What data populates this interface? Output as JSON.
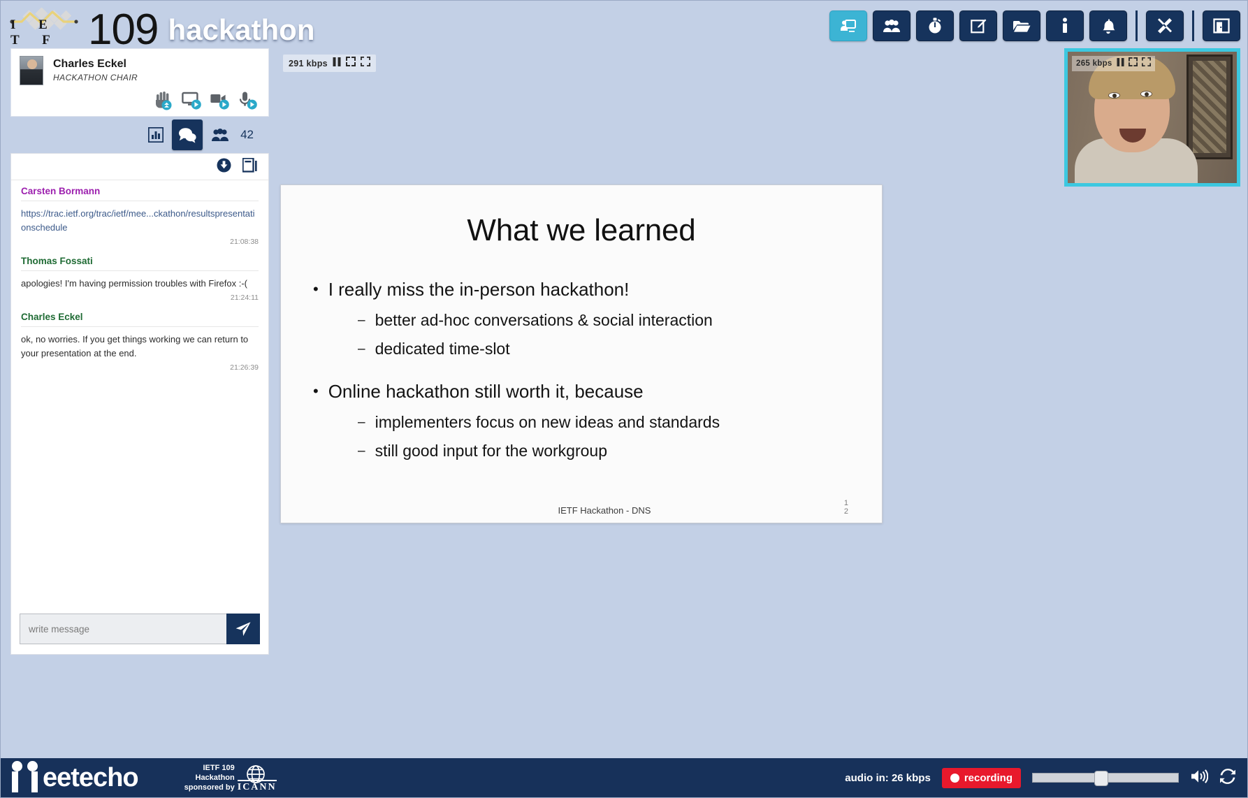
{
  "header": {
    "logo_letters": "I E T F",
    "number": "109",
    "event": "hackathon"
  },
  "toolbar": {
    "buttons": [
      {
        "name": "presentation-icon",
        "label": "Presentation",
        "active": true
      },
      {
        "name": "participants-icon",
        "label": "Participants",
        "active": false
      },
      {
        "name": "timer-icon",
        "label": "Timer",
        "active": false
      },
      {
        "name": "notes-icon",
        "label": "Notes",
        "active": false
      },
      {
        "name": "folder-icon",
        "label": "Materials",
        "active": false
      },
      {
        "name": "info-icon",
        "label": "Info",
        "active": false
      },
      {
        "name": "bell-icon",
        "label": "Notifications",
        "active": false
      },
      {
        "name": "tools-icon",
        "label": "Settings",
        "active": false
      },
      {
        "name": "exit-icon",
        "label": "Leave",
        "active": false
      }
    ]
  },
  "presenter": {
    "name": "Charles Eckel",
    "role": "HACKATHON CHAIR",
    "controls": [
      {
        "name": "raise-hand-icon",
        "label": "Raise hand"
      },
      {
        "name": "screen-share-icon",
        "label": "Share screen"
      },
      {
        "name": "camera-icon",
        "label": "Camera"
      },
      {
        "name": "microphone-icon",
        "label": "Microphone"
      }
    ]
  },
  "tabs": {
    "items": [
      {
        "name": "tab-polls",
        "label": "Polls",
        "active": false
      },
      {
        "name": "tab-chat",
        "label": "Chat",
        "active": true
      },
      {
        "name": "tab-participants",
        "label": "Participants",
        "active": false
      }
    ],
    "participant_count": "42"
  },
  "chat": {
    "actions": [
      {
        "name": "download-chat-icon",
        "label": "Download chat"
      },
      {
        "name": "popout-chat-icon",
        "label": "Pop out chat"
      }
    ],
    "messages": [
      {
        "author": "Carsten Bormann",
        "author_color": "#9c1fae",
        "text": "https://trac.ietf.org/trac/ietf/mee...ckathon/resultspresentationschedule",
        "is_link": true,
        "time": "21:08:38"
      },
      {
        "author": "Thomas Fossati",
        "author_color": "#1f6b34",
        "text": "apologies! I'm having permission troubles with Firefox :-(",
        "is_link": false,
        "time": "21:24:11"
      },
      {
        "author": "Charles Eckel",
        "author_color": "#1f6b34",
        "text": "ok, no worries. If you get things working we can return to your presentation at the end.",
        "is_link": false,
        "time": "21:26:39"
      }
    ],
    "input_placeholder": "write message",
    "input_value": "",
    "send_label": "Send"
  },
  "stage": {
    "bitrate": "291  kbps",
    "controls": [
      {
        "name": "pause-icon",
        "label": "Pause"
      },
      {
        "name": "resize-icon",
        "label": "Resize"
      },
      {
        "name": "fullscreen-icon",
        "label": "Fullscreen"
      }
    ]
  },
  "pip": {
    "bitrate": "265  kbps",
    "controls": [
      {
        "name": "pause-icon",
        "label": "Pause"
      },
      {
        "name": "resize-icon",
        "label": "Resize"
      },
      {
        "name": "fullscreen-icon",
        "label": "Fullscreen"
      }
    ]
  },
  "slide": {
    "title": "What we learned",
    "bullets": [
      {
        "text": "I really miss the in-person hackathon!",
        "sub": [
          "better ad-hoc conversations & social interaction",
          "dedicated time-slot"
        ]
      },
      {
        "text": "Online hackathon still worth it, because",
        "sub": [
          "implementers focus on new ideas and standards",
          "still good input for the workgroup"
        ]
      }
    ],
    "footer": "IETF Hackathon - DNS",
    "page_number": "1\n2"
  },
  "footer": {
    "brand": "eetecho",
    "sponsor_line1": "IETF 109",
    "sponsor_line2": "Hackathon",
    "sponsor_line3": "sponsored by",
    "sponsor_org": "ICANN",
    "audio_in": "audio in: 26 kbps",
    "recording_label": "recording",
    "volume_percent": 44,
    "right_icons": [
      {
        "name": "speaker-icon",
        "label": "Volume"
      },
      {
        "name": "reload-icon",
        "label": "Reload"
      }
    ]
  },
  "colors": {
    "navy": "#16335c",
    "accent_cyan": "#3cb4d4",
    "page_bg": "#c3d0e6",
    "recording_red": "#e8192c"
  }
}
